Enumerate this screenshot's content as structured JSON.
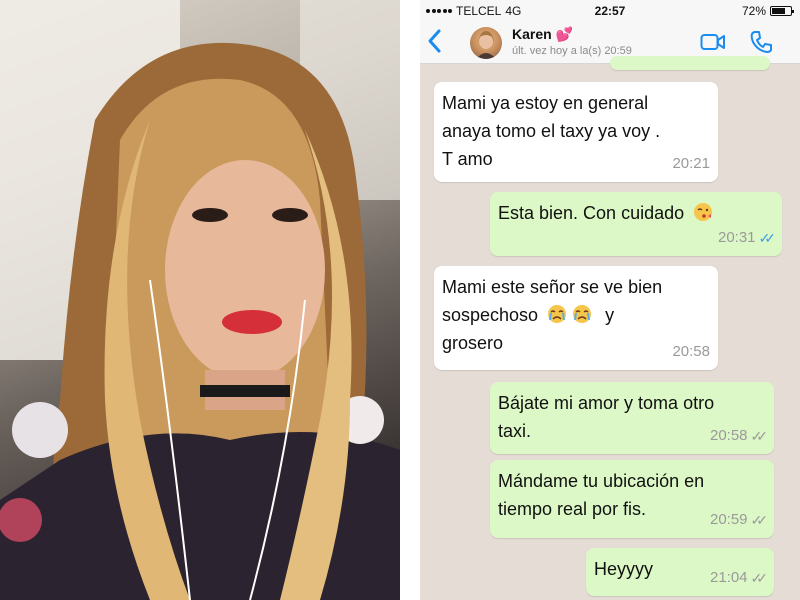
{
  "status_bar": {
    "carrier": "TELCEL",
    "network": "4G",
    "time": "22:57",
    "battery": "72%",
    "battery_level": 0.72
  },
  "chat_header": {
    "contact_name": "Karen 💕",
    "last_seen": "últ. vez hoy a la(s) 20:59",
    "back_icon": "chevron-left-icon",
    "video_icon": "video-camera-icon",
    "call_icon": "phone-icon"
  },
  "messages": [
    {
      "direction": "incoming",
      "lines": [
        "Mami ya estoy en general",
        "anaya tomo el taxy  ya voy .",
        "T  amo"
      ],
      "time": "20:21"
    },
    {
      "direction": "outgoing",
      "text": "Esta bien. Con cuidado",
      "emoji": "kissing-face-icon",
      "time": "20:31",
      "status": "read"
    },
    {
      "direction": "incoming",
      "lines": [
        "Mami este señor se ve bien",
        "sospechoso",
        "grosero"
      ],
      "line2_suffix": "y",
      "emoji": "crying-face-icon",
      "time": "20:58"
    },
    {
      "direction": "outgoing",
      "lines": [
        "Bájate mi amor y toma otro",
        "taxi."
      ],
      "time": "20:58",
      "status": "delivered"
    },
    {
      "direction": "outgoing",
      "lines": [
        "Mándame tu ubicación en",
        "tiempo real por fis."
      ],
      "time": "20:59",
      "status": "delivered"
    },
    {
      "direction": "outgoing",
      "text": "Heyyyy",
      "time": "21:04",
      "status": "delivered"
    }
  ],
  "colors": {
    "chat_background": "#e5ddd5",
    "incoming_bubble": "#ffffff",
    "outgoing_bubble": "#dcf8c6",
    "accent": "#1a8cf0",
    "read_ticks": "#3aa0e8"
  }
}
